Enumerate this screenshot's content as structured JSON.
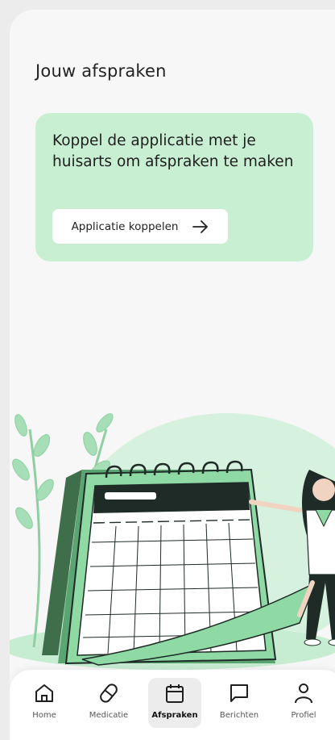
{
  "header": {
    "title": "Jouw afspraken"
  },
  "connect_card": {
    "message": "Koppel de applicatie met je huisarts om afspraken te maken",
    "button_label": "Applicatie koppelen",
    "button_icon": "arrow-right-icon"
  },
  "colors": {
    "accent_light": "#c9efd3",
    "accent": "#8fd9a5",
    "dark": "#1f2b26"
  },
  "nav": {
    "items": [
      {
        "label": "Home",
        "icon": "home-icon"
      },
      {
        "label": "Medicatie",
        "icon": "pill-icon"
      },
      {
        "label": "Afspraken",
        "icon": "calendar-icon",
        "active": true
      },
      {
        "label": "Berichten",
        "icon": "message-icon"
      },
      {
        "label": "Profiel",
        "icon": "user-icon"
      }
    ]
  }
}
